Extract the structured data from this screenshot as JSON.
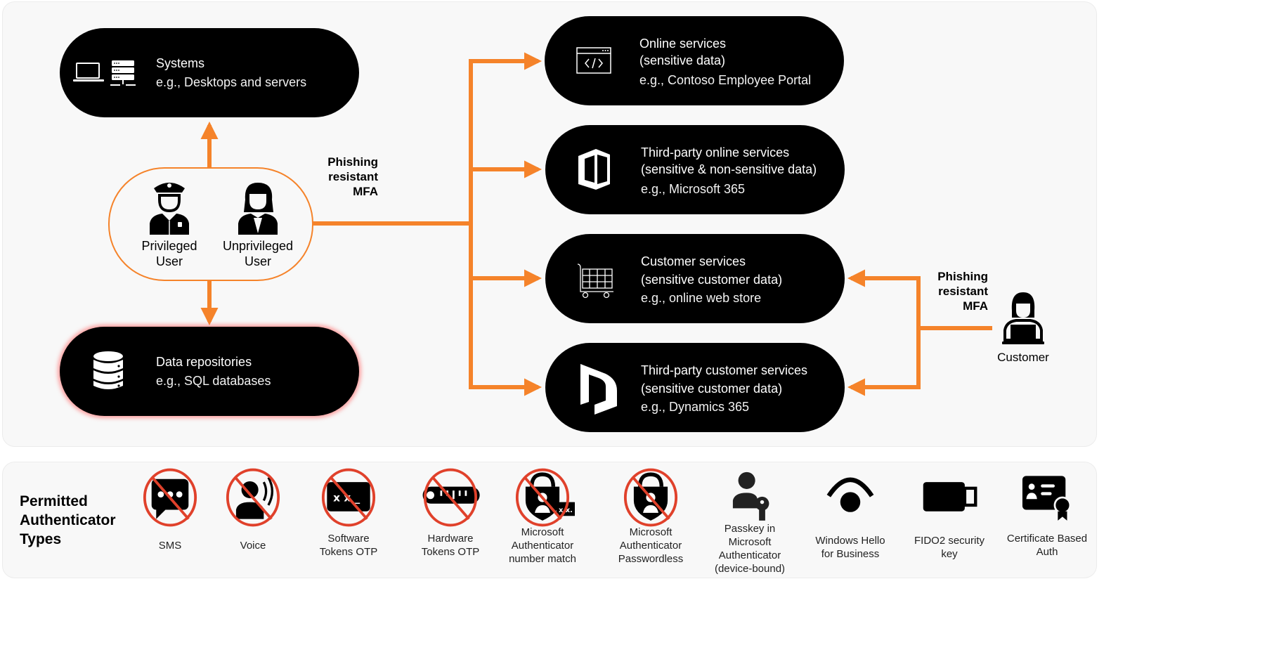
{
  "colors": {
    "accent_orange": "#f5832a",
    "pill_background": "#000000",
    "panel_background": "#f8f8f8",
    "forbidden_red": "#e0412b"
  },
  "left": {
    "systems": {
      "title": "Systems",
      "subtitle": "e.g., Desktops and servers",
      "icons": [
        "laptop-icon",
        "server-icon"
      ]
    },
    "data_repositories": {
      "title": "Data repositories",
      "subtitle": "e.g., SQL databases",
      "icon": "database-icon"
    },
    "users": [
      {
        "line1": "Privileged",
        "line2": "User",
        "icon": "police-officer-icon"
      },
      {
        "line1": "Unprivileged",
        "line2": "User",
        "icon": "woman-user-icon"
      }
    ],
    "mfa_label": [
      "Phishing",
      "resistant",
      "MFA"
    ]
  },
  "services": [
    {
      "title": "Online services",
      "title2": "(sensitive data)",
      "subtitle": "e.g., Contoso Employee Portal",
      "icon": "web-code-icon"
    },
    {
      "title": "Third-party online services",
      "title2": "(sensitive & non-sensitive data)",
      "subtitle": "e.g., Microsoft 365",
      "icon": "office-365-icon"
    },
    {
      "title": "Customer services",
      "title2": "(sensitive customer data)",
      "subtitle": "e.g., online web store",
      "icon": "shopping-cart-icon"
    },
    {
      "title": "Third-party customer services",
      "title2": "(sensitive customer data)",
      "subtitle": "e.g., Dynamics 365",
      "icon": "dynamics-365-icon"
    }
  ],
  "customer": {
    "label": "Customer",
    "icon": "customer-laptop-icon",
    "mfa_label": [
      "Phishing",
      "resistant",
      "MFA"
    ]
  },
  "authenticators": {
    "title": [
      "Permitted",
      "Authenticator",
      "Types"
    ],
    "items": [
      {
        "label": [
          "SMS"
        ],
        "permitted": false,
        "icon": "sms-icon"
      },
      {
        "label": [
          "Voice"
        ],
        "permitted": false,
        "icon": "voice-icon"
      },
      {
        "label": [
          "Software",
          "Tokens OTP"
        ],
        "permitted": false,
        "icon": "software-token-icon"
      },
      {
        "label": [
          "Hardware",
          "Tokens OTP"
        ],
        "permitted": false,
        "icon": "hardware-token-icon"
      },
      {
        "label": [
          "Microsoft",
          "Authenticator",
          "number match"
        ],
        "permitted": false,
        "icon": "authenticator-number-match-icon"
      },
      {
        "label": [
          "Microsoft",
          "Authenticator",
          "Passwordless"
        ],
        "permitted": false,
        "icon": "authenticator-passwordless-icon"
      },
      {
        "label": [
          "Passkey in",
          "Microsoft",
          "Authenticator",
          "(device-bound)"
        ],
        "permitted": true,
        "icon": "passkey-icon"
      },
      {
        "label": [
          "Windows Hello",
          "for Business"
        ],
        "permitted": true,
        "icon": "windows-hello-icon"
      },
      {
        "label": [
          "FIDO2 security",
          "key"
        ],
        "permitted": true,
        "icon": "fido2-key-icon"
      },
      {
        "label": [
          "Certificate Based",
          "Auth"
        ],
        "permitted": true,
        "icon": "certificate-icon"
      }
    ]
  }
}
